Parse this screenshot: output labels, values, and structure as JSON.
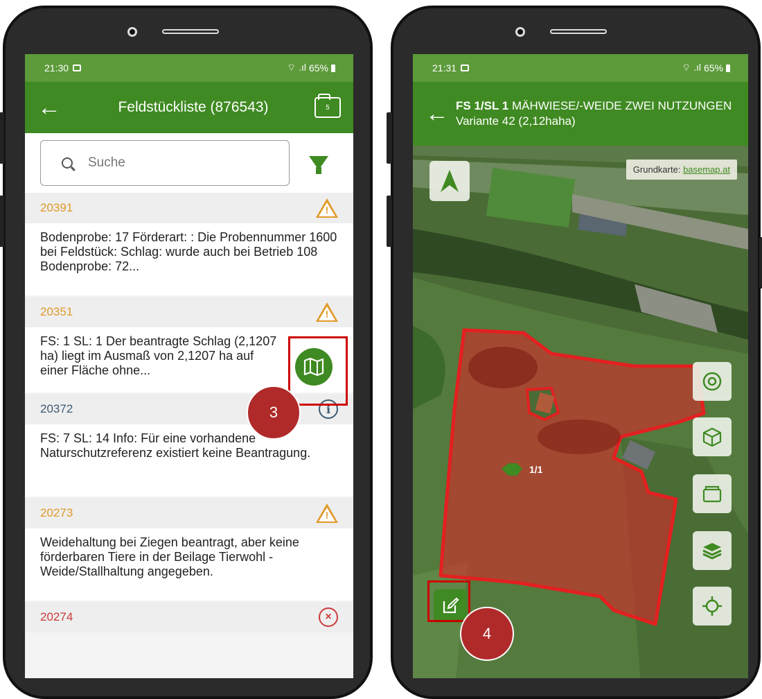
{
  "left_phone": {
    "status": {
      "time": "21:30",
      "battery": "65%"
    },
    "header": {
      "title": "Feldstückliste (876543)",
      "folder_count": "5"
    },
    "search": {
      "placeholder": "Suche"
    },
    "messages": [
      {
        "code": "20391",
        "level": "warning",
        "text": "Bodenprobe: 17 Förderart: : Die Probennummer 1600 bei Feldstück: Schlag: wurde auch bei Betrieb 108 Bodenprobe: 72..."
      },
      {
        "code": "20351",
        "level": "warning",
        "text": "FS: 1 SL: 1 Der beantragte Schlag (2,1207 ha) liegt im Ausmaß von 2,1207 ha auf einer Fläche ohne..."
      },
      {
        "code": "20372",
        "level": "info",
        "text": "FS: 7 SL: 14 Info: Für eine vorhandene Naturschutzreferenz existiert keine Beantragung."
      },
      {
        "code": "20273",
        "level": "warning",
        "text": "Weidehaltung bei Ziegen beantragt, aber keine förderbaren Tiere in der Beilage Tierwohl - Weide/Stallhaltung angegeben."
      },
      {
        "code": "20274",
        "level": "error",
        "text": ""
      }
    ],
    "step_badge": "3",
    "icons": {
      "back": "arrow-left-icon",
      "folder": "folder-icon",
      "search": "search-icon",
      "filter": "filter-icon",
      "map": "map-icon"
    }
  },
  "right_phone": {
    "status": {
      "time": "21:31",
      "battery": "65%"
    },
    "header": {
      "title_bold": "FS 1/SL 1",
      "title_rest": " MÄHWIESE/-WEIDE ZWEI NUTZUNGEN Variante 42 (2,12haha)"
    },
    "map": {
      "attribution_label": "Grundkarte: ",
      "attribution_link": "basemap.at",
      "parcel_label": "1/1",
      "parcel_color": "#d42a2a"
    },
    "step_badge": "4",
    "icons": [
      "compass-icon",
      "target-icon",
      "cube-icon",
      "folder-icon",
      "layers-icon",
      "locate-icon",
      "edit-icon"
    ]
  }
}
